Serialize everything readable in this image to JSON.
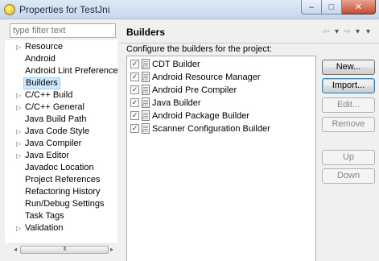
{
  "window": {
    "title": "Properties for TestJni",
    "minimize_glyph": "–",
    "maximize_glyph": "□",
    "close_glyph": "✕"
  },
  "left": {
    "filter_placeholder": "type filter text",
    "tree": [
      {
        "label": "Resource",
        "expandable": true,
        "selected": false
      },
      {
        "label": "Android",
        "expandable": false,
        "selected": false
      },
      {
        "label": "Android Lint Preferences",
        "expandable": false,
        "selected": false
      },
      {
        "label": "Builders",
        "expandable": false,
        "selected": true
      },
      {
        "label": "C/C++ Build",
        "expandable": true,
        "selected": false
      },
      {
        "label": "C/C++ General",
        "expandable": true,
        "selected": false
      },
      {
        "label": "Java Build Path",
        "expandable": false,
        "selected": false
      },
      {
        "label": "Java Code Style",
        "expandable": true,
        "selected": false
      },
      {
        "label": "Java Compiler",
        "expandable": true,
        "selected": false
      },
      {
        "label": "Java Editor",
        "expandable": true,
        "selected": false
      },
      {
        "label": "Javadoc Location",
        "expandable": false,
        "selected": false
      },
      {
        "label": "Project References",
        "expandable": false,
        "selected": false
      },
      {
        "label": "Refactoring History",
        "expandable": false,
        "selected": false
      },
      {
        "label": "Run/Debug Settings",
        "expandable": false,
        "selected": false
      },
      {
        "label": "Task Tags",
        "expandable": false,
        "selected": false
      },
      {
        "label": "Validation",
        "expandable": true,
        "selected": false
      }
    ],
    "expand_glyph": "▷",
    "scroll_left": "◂",
    "scroll_right": "▸",
    "scroll_grip": "III"
  },
  "right": {
    "title": "Builders",
    "nav_back": "⇦",
    "nav_forward": "⇨",
    "nav_menu": "▾",
    "description": "Configure the builders for the project:",
    "check_glyph": "✓",
    "builders": [
      {
        "label": "CDT Builder",
        "checked": true
      },
      {
        "label": "Android Resource Manager",
        "checked": true
      },
      {
        "label": "Android Pre Compiler",
        "checked": true
      },
      {
        "label": "Java Builder",
        "checked": true
      },
      {
        "label": "Android Package Builder",
        "checked": true
      },
      {
        "label": "Scanner Configuration Builder",
        "checked": true
      }
    ],
    "buttons": {
      "new": "New...",
      "import": "Import...",
      "edit": "Edit...",
      "remove": "Remove",
      "up": "Up",
      "down": "Down"
    }
  }
}
